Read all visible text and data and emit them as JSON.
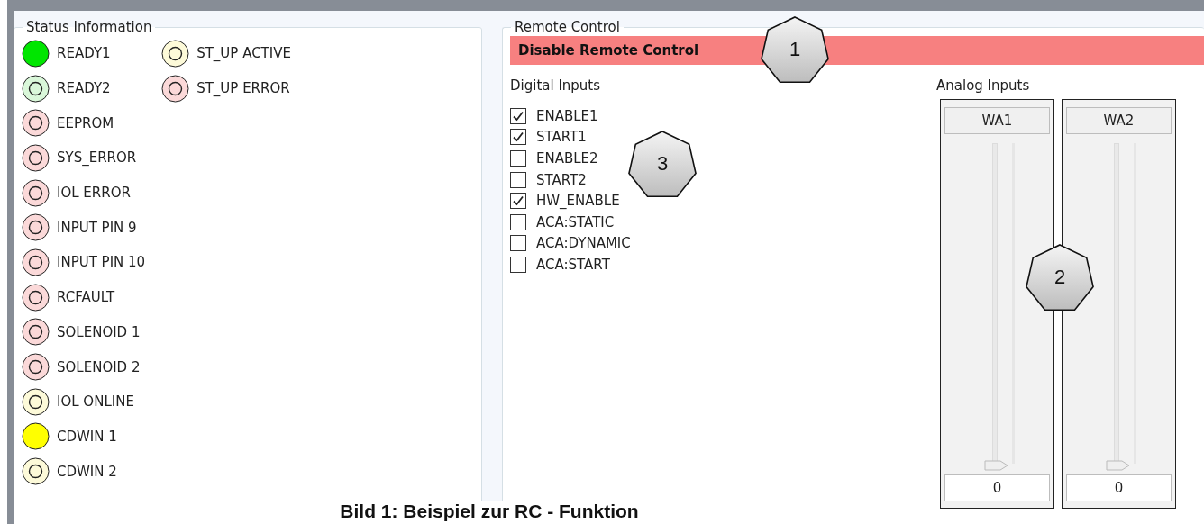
{
  "status": {
    "title": "Status Information",
    "columns": [
      [
        {
          "label": "READY1",
          "color": "#00e600",
          "on": true
        },
        {
          "label": "READY2",
          "color": "#d9f7d9",
          "on": false
        },
        {
          "label": "EEPROM",
          "color": "#fbd9d9",
          "on": false
        },
        {
          "label": "SYS_ERROR",
          "color": "#fbd9d9",
          "on": false
        },
        {
          "label": "IOL ERROR",
          "color": "#fbd9d9",
          "on": false
        },
        {
          "label": "INPUT PIN 9",
          "color": "#fbd9d9",
          "on": false
        },
        {
          "label": "INPUT PIN 10",
          "color": "#fbd9d9",
          "on": false
        },
        {
          "label": "RCFAULT",
          "color": "#fbd9d9",
          "on": false
        },
        {
          "label": "SOLENOID 1",
          "color": "#fbd9d9",
          "on": false
        },
        {
          "label": "SOLENOID 2",
          "color": "#fbd9d9",
          "on": false
        },
        {
          "label": "IOL ONLINE",
          "color": "#fdfad9",
          "on": false
        },
        {
          "label": "CDWIN 1",
          "color": "#ffff00",
          "on": true
        },
        {
          "label": "CDWIN 2",
          "color": "#fdfad9",
          "on": false
        }
      ],
      [
        {
          "label": "ST_UP ACTIVE",
          "color": "#fdfad9",
          "on": false
        },
        {
          "label": "ST_UP ERROR",
          "color": "#fbd9d9",
          "on": false
        }
      ]
    ]
  },
  "remote": {
    "title": "Remote Control",
    "toggle_button": "Disable Remote Control",
    "digital": {
      "title": "Digital Inputs",
      "inputs": [
        {
          "label": "ENABLE1",
          "checked": true
        },
        {
          "label": "START1",
          "checked": true
        },
        {
          "label": "ENABLE2",
          "checked": false
        },
        {
          "label": "START2",
          "checked": false
        },
        {
          "label": "HW_ENABLE",
          "checked": true
        },
        {
          "label": "ACA:STATIC",
          "checked": false
        },
        {
          "label": "ACA:DYNAMIC",
          "checked": false
        },
        {
          "label": "ACA:START",
          "checked": false
        }
      ]
    },
    "analog": {
      "title": "Analog Inputs",
      "channels": [
        {
          "name": "WA1",
          "level": 0,
          "value": "0"
        },
        {
          "name": "WA2",
          "level": 0,
          "value": "0"
        }
      ]
    }
  },
  "callouts": [
    "1",
    "3",
    "2"
  ],
  "caption": "Bild 1: Beispiel zur RC - Funktion"
}
